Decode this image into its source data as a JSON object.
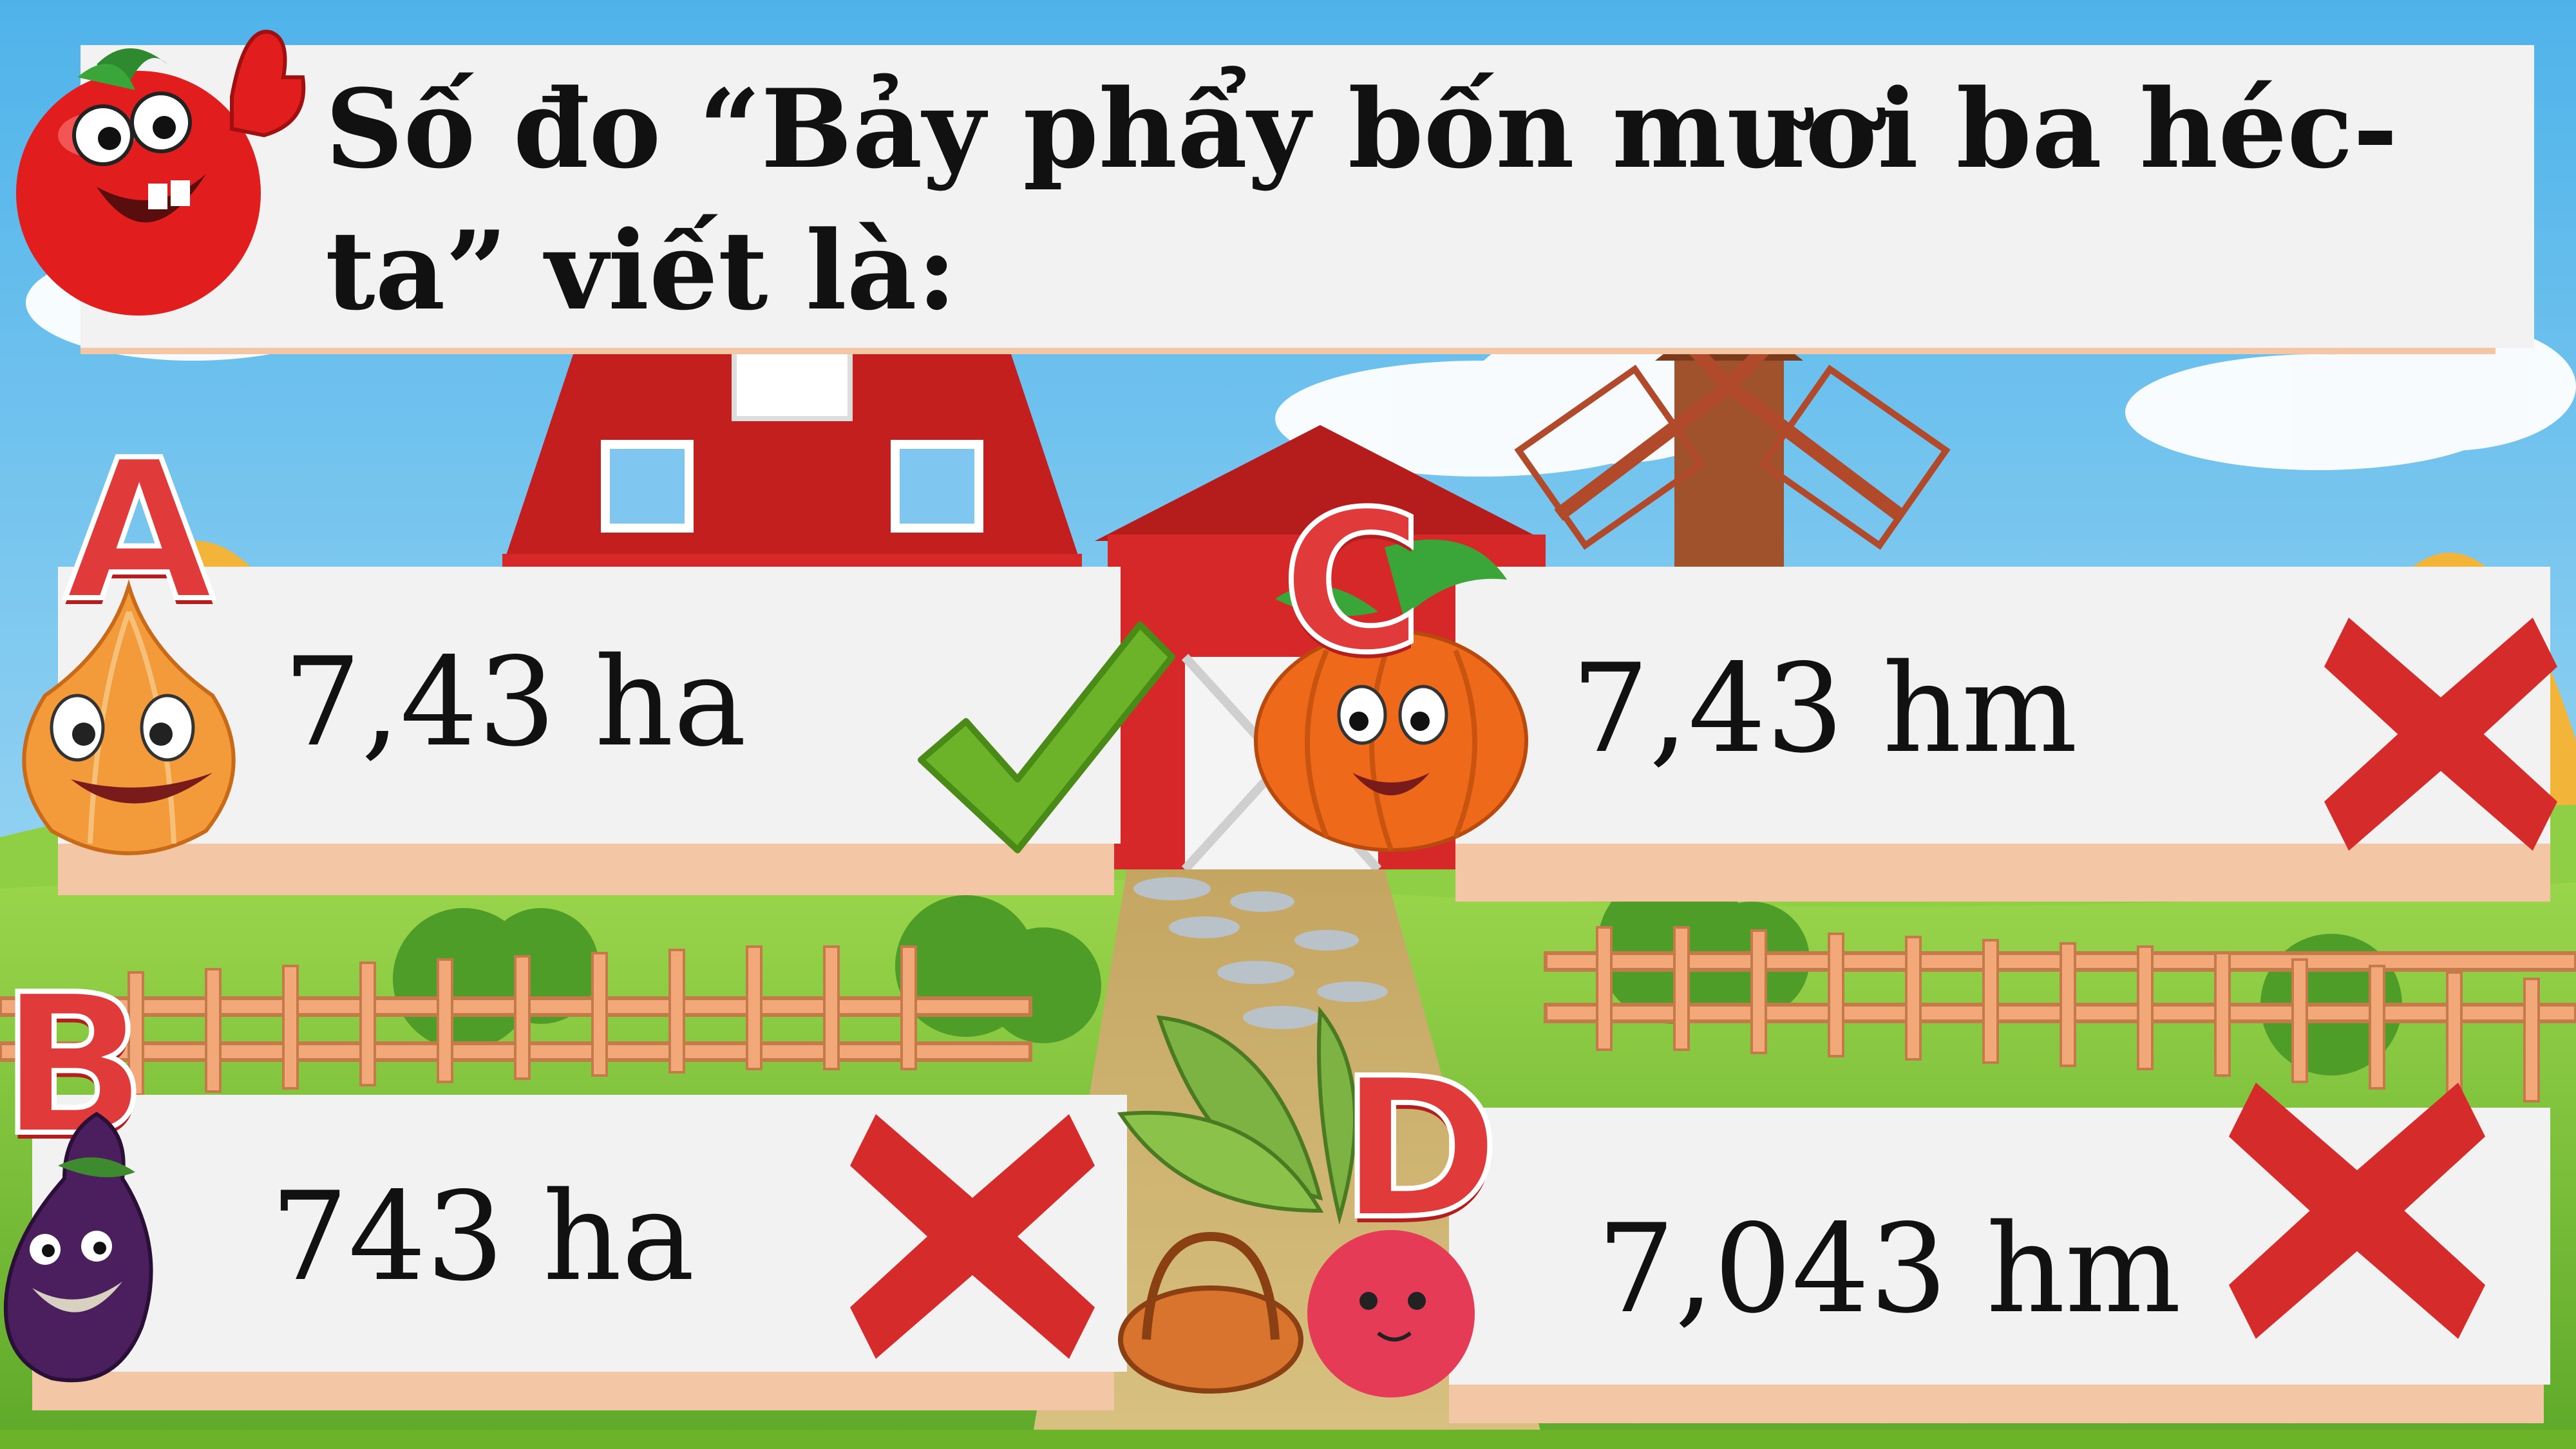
{
  "question": {
    "text": "Số đo “Bảy phẩy bốn mươi ba héc-ta” viết là:"
  },
  "answers": [
    {
      "letter": "A",
      "value": "7,43 ha",
      "result": "correct",
      "mark_icon": "check-icon"
    },
    {
      "letter": "B",
      "value": "743 ha",
      "result": "wrong",
      "mark_icon": "x-icon"
    },
    {
      "letter": "C",
      "value": "7,43 hm",
      "result": "wrong",
      "mark_icon": "x-icon"
    },
    {
      "letter": "D",
      "value": "7,043 hm",
      "result": "wrong",
      "mark_icon": "x-icon"
    }
  ],
  "colors": {
    "card": "#f2f2f2",
    "card_shadow": "#f3c7a5",
    "letter": "#e03a3a",
    "check": "#6cb32a",
    "cross": "#d62b2b",
    "sky": "#6ec3ee",
    "grass": "#7cc23a",
    "barn": "#d62828"
  },
  "characters": [
    "tomato-mascot",
    "onion-character",
    "eggplant-character",
    "pumpkin-character",
    "radish-character"
  ]
}
